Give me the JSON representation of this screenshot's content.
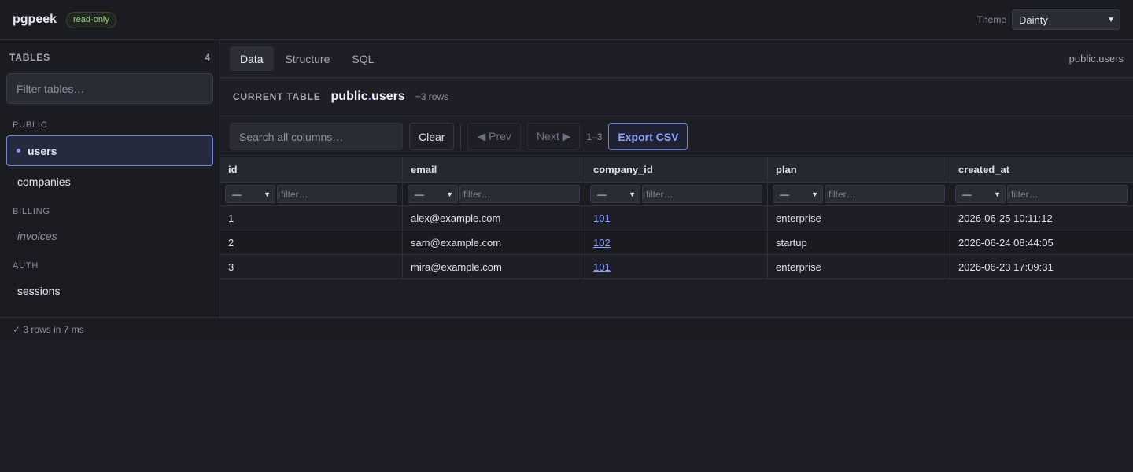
{
  "app": {
    "name": "pgpeek",
    "badge": "read-only"
  },
  "theme": {
    "label": "Theme",
    "value": "Dainty"
  },
  "sidebar": {
    "title": "TABLES",
    "count": "4",
    "filter_placeholder": "Filter tables…",
    "groups": [
      {
        "label": "PUBLIC",
        "items": [
          {
            "label": "users",
            "active": true
          },
          {
            "label": "companies"
          }
        ]
      },
      {
        "label": "BILLING",
        "items": [
          {
            "label": "invoices",
            "muted": true
          }
        ]
      },
      {
        "label": "AUTH",
        "items": [
          {
            "label": "sessions"
          }
        ]
      }
    ]
  },
  "tabs": [
    {
      "label": "Data",
      "active": true
    },
    {
      "label": "Structure"
    },
    {
      "label": "SQL"
    }
  ],
  "breadcrumb": "public.users",
  "current": {
    "label": "CURRENT TABLE",
    "schema": "public",
    "separator": ".",
    "table": "users",
    "rows": "~3 rows"
  },
  "toolbar": {
    "search_placeholder": "Search all columns…",
    "clear": "Clear",
    "prev": "◀ Prev",
    "next": "Next ▶",
    "range": "1–3",
    "export": "Export CSV"
  },
  "grid": {
    "columns": [
      "id",
      "email",
      "company_id",
      "plan",
      "created_at"
    ],
    "filter_op": "—",
    "filter_placeholder": "filter…",
    "rows": [
      [
        "1",
        "alex@example.com",
        "101",
        "enterprise",
        "2026-06-25 10:11:12"
      ],
      [
        "2",
        "sam@example.com",
        "102",
        "startup",
        "2026-06-24 08:44:05"
      ],
      [
        "3",
        "mira@example.com",
        "101",
        "enterprise",
        "2026-06-23 17:09:31"
      ]
    ]
  },
  "status": "✓ 3 rows in 7 ms"
}
